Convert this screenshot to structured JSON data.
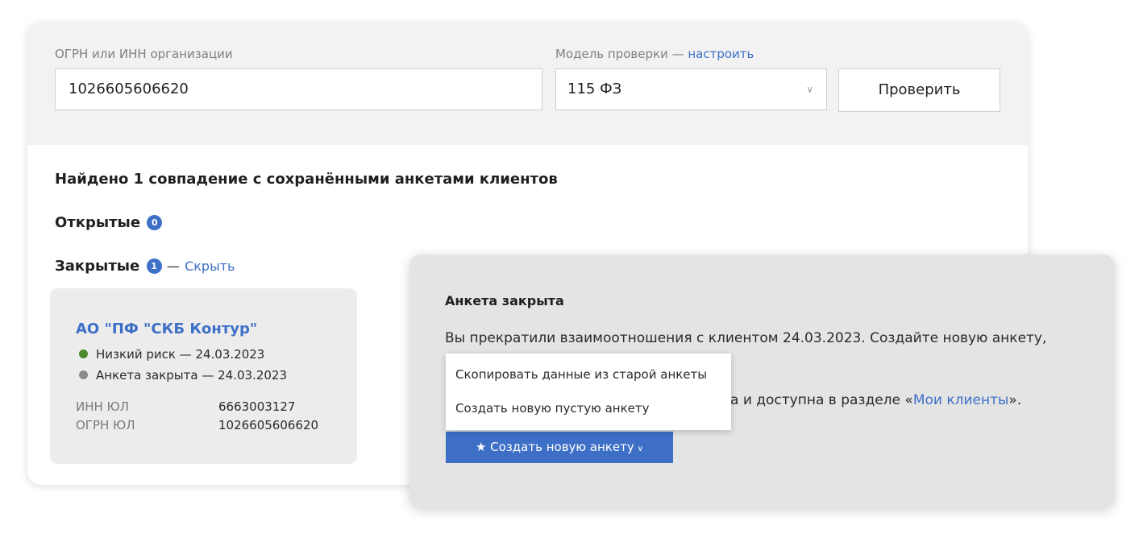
{
  "search": {
    "org_label": "ОГРН или ИНН организации",
    "org_value": "1026605606620",
    "model_label": "Модель проверки — ",
    "model_link": "настроить",
    "model_value": "115 ФЗ",
    "check_button": "Проверить"
  },
  "results": {
    "found_title": "Найдено 1 совпадение с сохранёнными анкетами клиентов",
    "open_label": "Открытые",
    "open_count": "0",
    "closed_label": "Закрытые",
    "closed_count": "1",
    "dash": "—",
    "hide_link": "Скрыть"
  },
  "client": {
    "name": "АО \"ПФ \"СКБ Контур\"",
    "statuses": [
      {
        "text": "Низкий риск — 24.03.2023",
        "color": "#4a8a2c"
      },
      {
        "text": "Анкета закрыта — 24.03.2023",
        "color": "#8a8a8a"
      }
    ],
    "ids": [
      {
        "label": "ИНН ЮЛ",
        "value": "6663003127"
      },
      {
        "label": "ОГРН ЮЛ",
        "value": "1026605606620"
      }
    ]
  },
  "popup": {
    "title": "Анкета закрыта",
    "line1": "Вы прекратили взаимоотношения с клиентом 24.03.2023. Создайте новую анкету,",
    "line3_prefix": "а и доступна в разделе «",
    "line3_link": "Мои клиенты",
    "line3_suffix": "».",
    "create_button": "★ Создать новую анкету",
    "create_chevron": "chevron-down-icon",
    "menu": [
      "Скопировать данные из старой анкеты",
      "Создать новую пустую анкету"
    ]
  },
  "colors": {
    "accent": "#3d6fc7",
    "low_risk": "#4a8a2c",
    "closed": "#8a8a8a"
  }
}
